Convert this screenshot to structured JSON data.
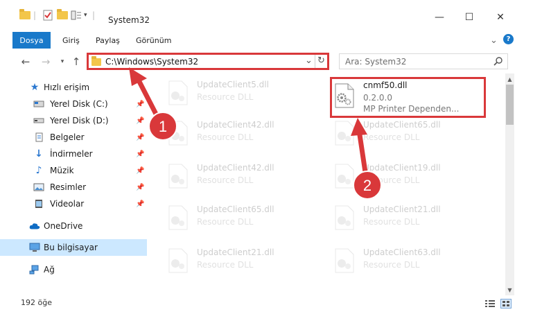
{
  "window": {
    "title": "System32",
    "minimize_glyph": "—",
    "maximize_glyph": "☐",
    "close_glyph": "✕"
  },
  "ribbon": {
    "tabs": [
      {
        "label": "Dosya",
        "active": true
      },
      {
        "label": "Giriş"
      },
      {
        "label": "Paylaş"
      },
      {
        "label": "Görünüm"
      }
    ],
    "expand_glyph": "⌄",
    "help_glyph": "?"
  },
  "address": {
    "path": "C:\\Windows\\System32",
    "dropdown_glyph": "⌄",
    "refresh_glyph": "↻"
  },
  "search": {
    "placeholder": "Ara: System32",
    "icon": "search-icon"
  },
  "sidebar": {
    "items": [
      {
        "label": "Hızlı erişim",
        "icon": "star-icon",
        "pinned": false
      },
      {
        "label": "Yerel Disk (C:)",
        "icon": "drive-icon",
        "pinned": true
      },
      {
        "label": "Yerel Disk (D:)",
        "icon": "drive-icon",
        "pinned": true
      },
      {
        "label": "Belgeler",
        "icon": "documents-icon",
        "pinned": true
      },
      {
        "label": "İndirmeler",
        "icon": "download-icon",
        "pinned": true
      },
      {
        "label": "Müzik",
        "icon": "music-icon",
        "pinned": true
      },
      {
        "label": "Resimler",
        "icon": "pictures-icon",
        "pinned": true
      },
      {
        "label": "Videolar",
        "icon": "videos-icon",
        "pinned": true
      },
      {
        "label": "OneDrive",
        "icon": "cloud-icon",
        "pinned": false
      },
      {
        "label": "Bu bilgisayar",
        "icon": "computer-icon",
        "pinned": false,
        "selected": true
      },
      {
        "label": "Ağ",
        "icon": "network-icon",
        "pinned": false
      }
    ]
  },
  "files": {
    "left_column": [
      {
        "name": "UpdateClient5.dll",
        "type": "Resource DLL"
      },
      {
        "name": "UpdateClient42.dll",
        "type": "Resource DLL"
      },
      {
        "name": "UpdateClient42.dll",
        "type": "Resource DLL"
      },
      {
        "name": "UpdateClient65.dll",
        "type": "Resource DLL"
      },
      {
        "name": "UpdateClient21.dll",
        "type": "Resource DLL"
      }
    ],
    "right_column": [
      {
        "name": "UpdateClient65.dll",
        "type": "Resource DLL"
      },
      {
        "name": "UpdateClient19.dll",
        "type": "Resource DLL"
      },
      {
        "name": "UpdateClient21.dll",
        "type": "Resource DLL"
      },
      {
        "name": "UpdateClient63.dll",
        "type": "Resource DLL"
      }
    ],
    "highlighted": {
      "name": "cnmf50.dll",
      "version": "0.2.0.0",
      "description": "MP Printer Dependen..."
    }
  },
  "status": {
    "item_count": "192 öğe"
  },
  "annotations": {
    "step1": "1",
    "step2": "2",
    "color": "#d9383a"
  }
}
